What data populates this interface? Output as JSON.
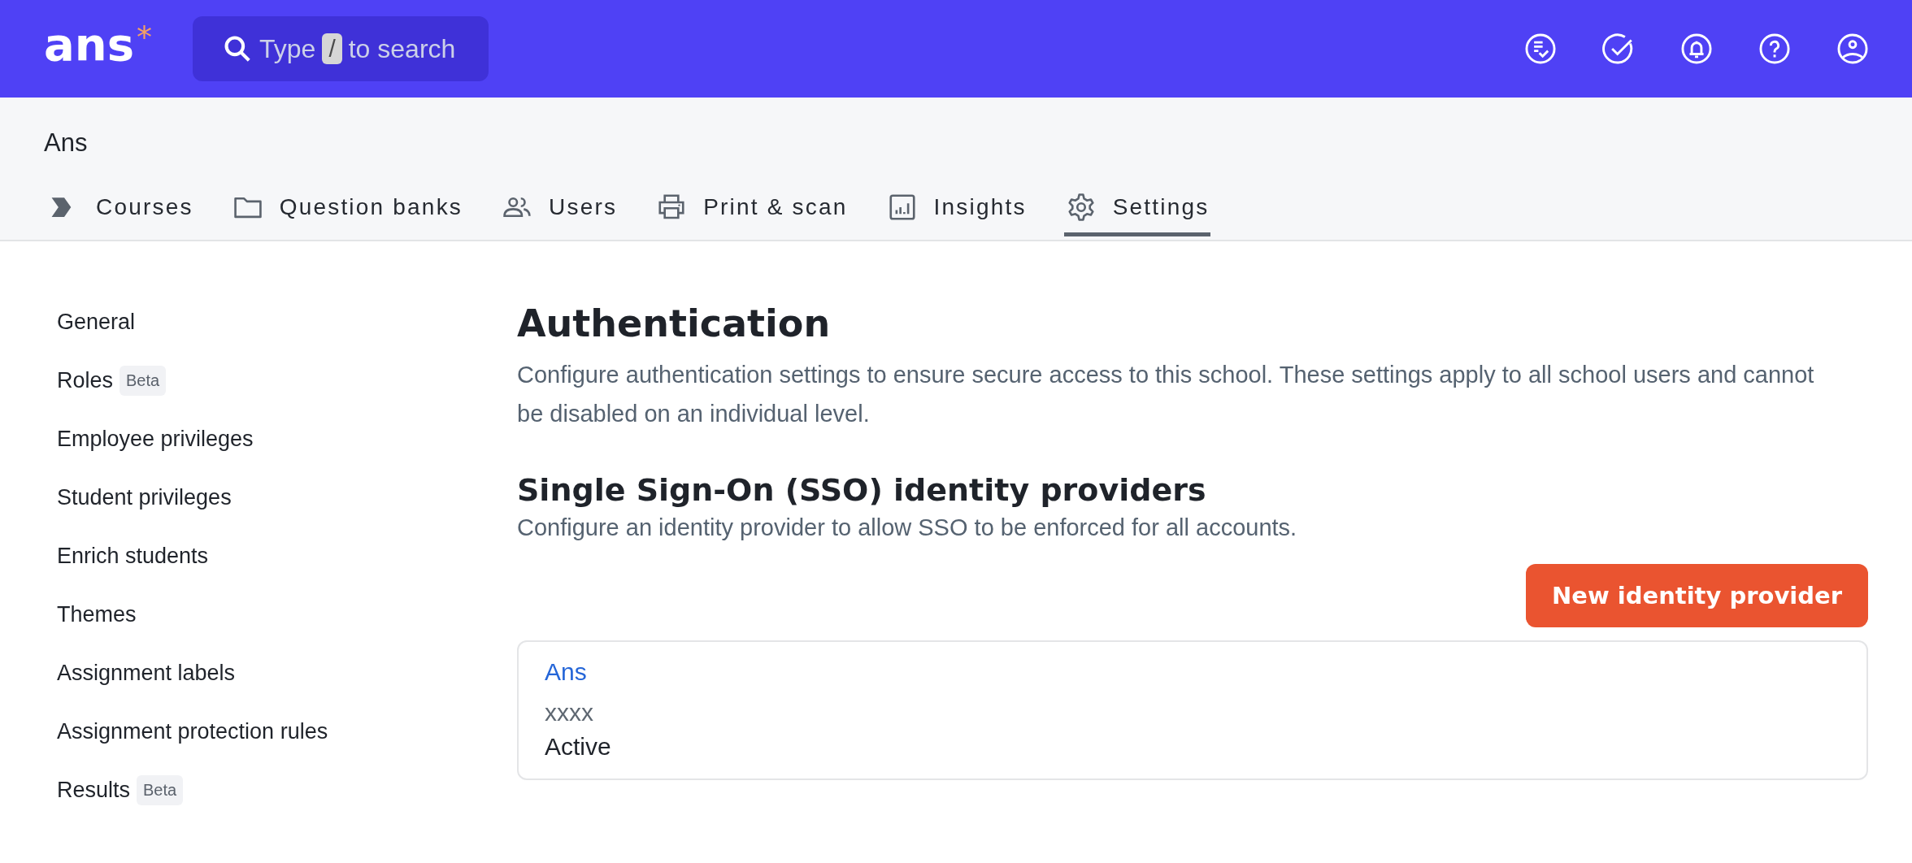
{
  "logo": {
    "text": "ans",
    "mark": "*"
  },
  "search": {
    "before": "Type",
    "key": "/",
    "after": "to search"
  },
  "org": {
    "name": "Ans"
  },
  "tabs": [
    {
      "label": "Courses",
      "selected": false
    },
    {
      "label": "Question banks",
      "selected": false
    },
    {
      "label": "Users",
      "selected": false
    },
    {
      "label": "Print & scan",
      "selected": false
    },
    {
      "label": "Insights",
      "selected": false
    },
    {
      "label": "Settings",
      "selected": true
    }
  ],
  "sidebar": {
    "items": [
      {
        "label": "General"
      },
      {
        "label": "Roles",
        "badge": "Beta"
      },
      {
        "label": "Employee privileges"
      },
      {
        "label": "Student privileges"
      },
      {
        "label": "Enrich students"
      },
      {
        "label": "Themes"
      },
      {
        "label": "Assignment labels"
      },
      {
        "label": "Assignment protection rules"
      },
      {
        "label": "Results",
        "badge": "Beta"
      }
    ]
  },
  "content": {
    "title": "Authentication",
    "description": "Configure authentication settings to ensure secure access to this school. These settings apply to all school users and cannot be disabled on an individual level.",
    "section_title": "Single Sign-On (SSO) identity providers",
    "section_description": "Configure an identity provider to allow SSO to be enforced for all accounts.",
    "button": "New identity provider",
    "providers": [
      {
        "name": "Ans",
        "detail": "xxxx",
        "status": "Active"
      }
    ]
  }
}
